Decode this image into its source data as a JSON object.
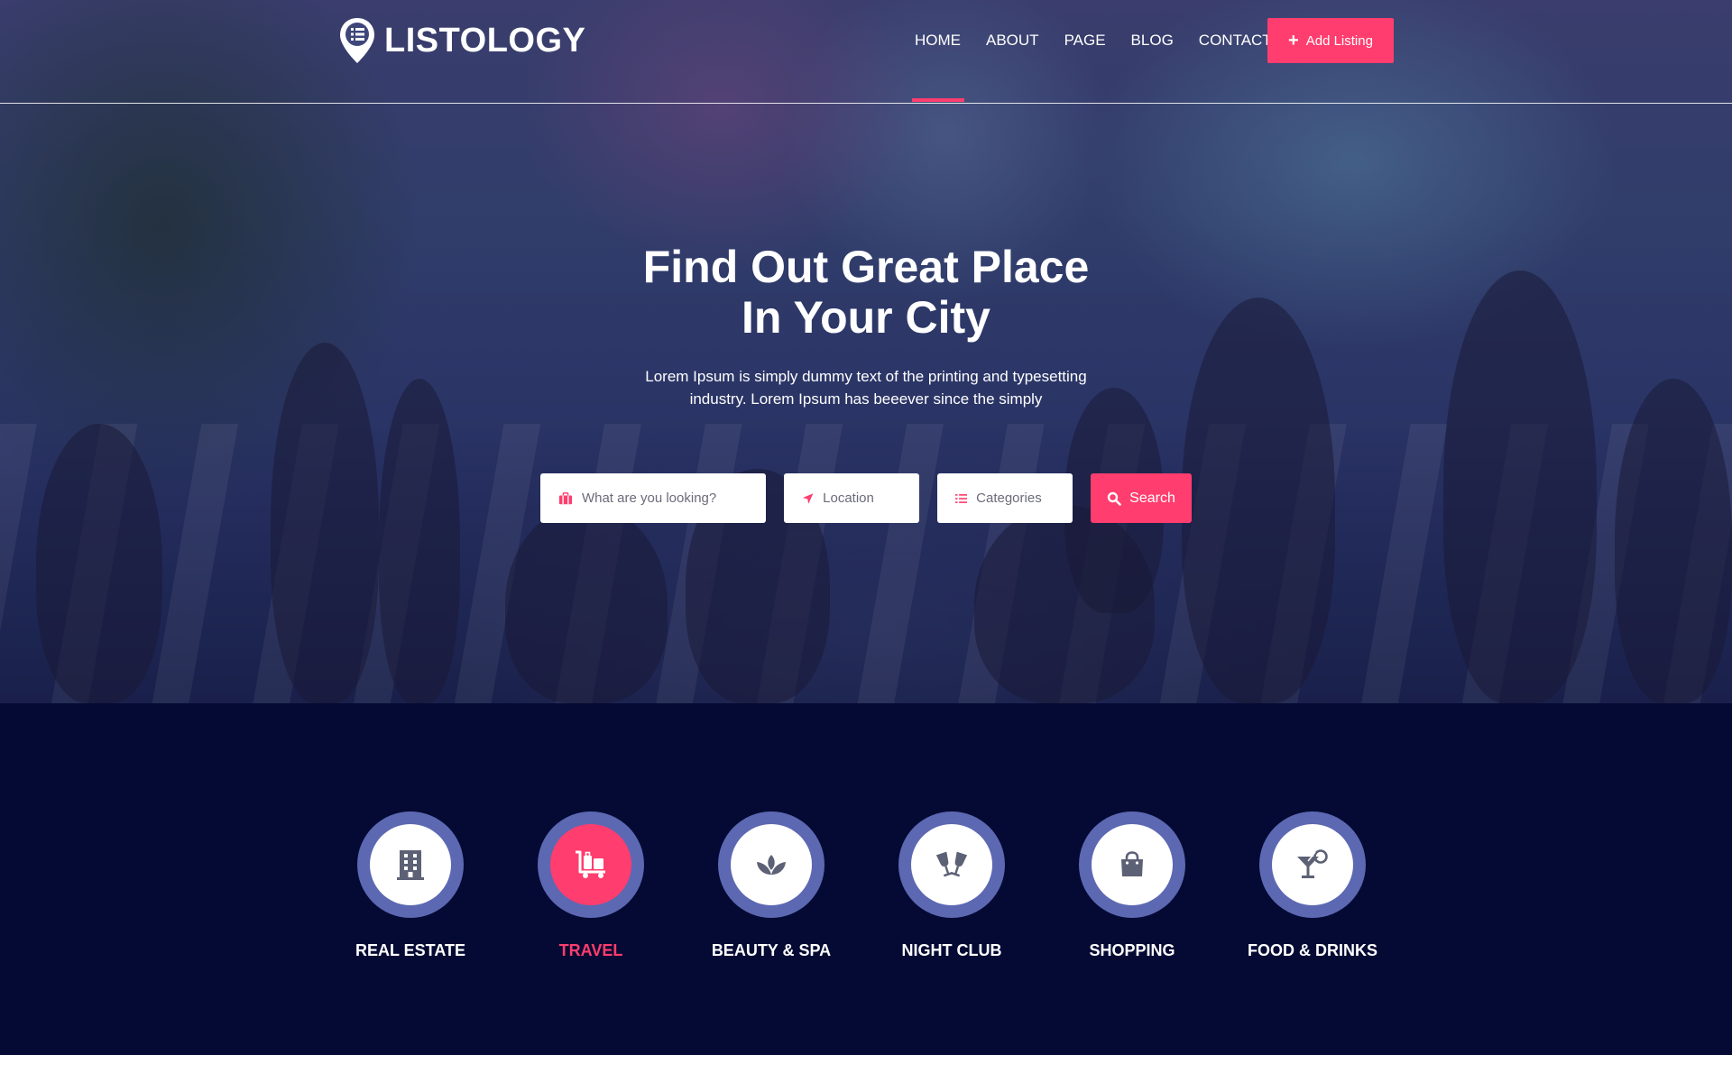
{
  "brand": {
    "name": "LISTOLOGY",
    "accent": "#ff3d6e",
    "navy": "#040a33",
    "ring": "#5c68b2"
  },
  "nav": {
    "items": [
      {
        "label": "HOME",
        "active": true
      },
      {
        "label": "ABOUT"
      },
      {
        "label": "PAGE"
      },
      {
        "label": "BLOG"
      },
      {
        "label": "CONTACT"
      }
    ],
    "add_listing_label": "Add Listing",
    "add_listing_icon": "plus-icon"
  },
  "hero": {
    "title_line1": "Find Out Great Place",
    "title_line2": "In Your City",
    "subtitle_line1": "Lorem Ipsum is simply dummy text of the printing and typesetting",
    "subtitle_line2": "industry. Lorem Ipsum has beeever since the simply"
  },
  "search": {
    "what_placeholder": "What are you looking?",
    "what_icon": "briefcase-icon",
    "location_placeholder": "Location",
    "location_icon": "location-arrow-icon",
    "categories_placeholder": "Categories",
    "categories_icon": "list-icon",
    "button_label": "Search",
    "button_icon": "search-icon"
  },
  "categories": [
    {
      "label": "REAL ESTATE",
      "icon": "building-icon"
    },
    {
      "label": "TRAVEL",
      "icon": "luggage-cart-icon",
      "active": true
    },
    {
      "label": "BEAUTY & SPA",
      "icon": "spa-icon"
    },
    {
      "label": "NIGHT CLUB",
      "icon": "glass-cheers-icon"
    },
    {
      "label": "SHOPPING",
      "icon": "shopping-bag-icon"
    },
    {
      "label": "FOOD & DRINKS",
      "icon": "cocktail-icon"
    }
  ]
}
